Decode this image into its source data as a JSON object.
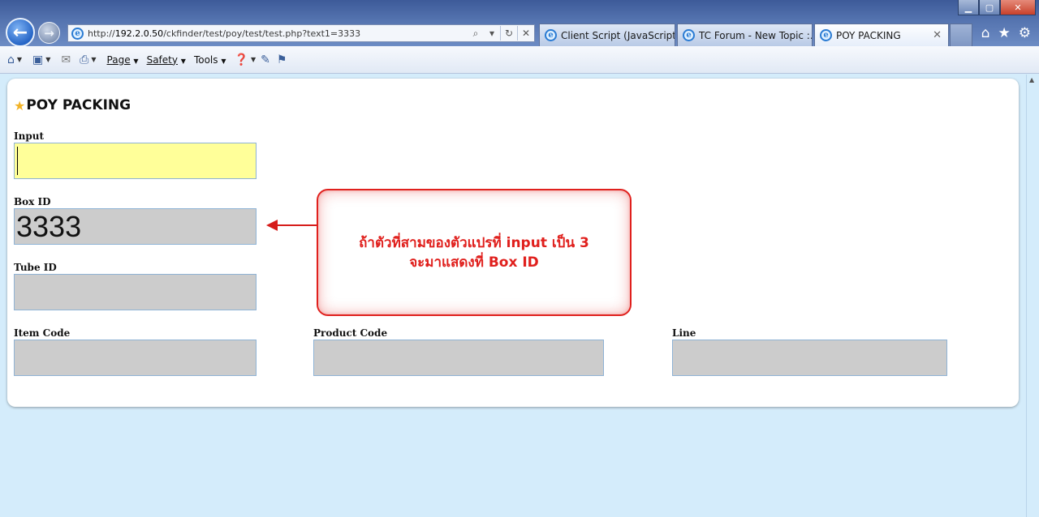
{
  "browser": {
    "url_prefix": "http://",
    "url_host": "192.2.0.50",
    "url_path": "/ckfinder/test/poy/test/test.php?text1=3333",
    "tabs": [
      {
        "label": "Client Script (JavaScript, ...",
        "active": false
      },
      {
        "label": "TC Forum - New Topic :...",
        "active": false
      },
      {
        "label": "POY PACKING",
        "active": true
      }
    ],
    "window_controls": {
      "minimize": "▁",
      "maximize": "▢",
      "close": "✕"
    },
    "right_icons": [
      "home-icon",
      "favorites-star-icon",
      "settings-gear-icon"
    ]
  },
  "command_bar": {
    "menus": [
      {
        "label": "Page"
      },
      {
        "label": "Safety"
      },
      {
        "label": "Tools"
      }
    ],
    "icons": [
      "home-icon",
      "feeds-icon",
      "mail-icon",
      "print-icon",
      "help-icon",
      "research-icon",
      "translate-icon"
    ]
  },
  "page": {
    "title": "POY PACKING",
    "title_icon": "star-icon",
    "fields": {
      "input": {
        "label": "Input",
        "value": "",
        "color": "#ffff99"
      },
      "box_id": {
        "label": "Box ID",
        "value": "3333",
        "color": "#cccccc"
      },
      "tube_id": {
        "label": "Tube ID",
        "value": "",
        "color": "#cccccc"
      },
      "item_code": {
        "label": "Item Code",
        "value": "",
        "color": "#cccccc"
      },
      "product_code": {
        "label": "Product Code",
        "value": "",
        "color": "#cccccc"
      },
      "line": {
        "label": "Line",
        "value": "",
        "color": "#cccccc"
      }
    }
  },
  "annotation": {
    "line1": "ถ้าตัวที่สามของตัวแปรที่ input เป็น 3",
    "line2": "จะมาแสดงที่ Box ID",
    "color": "#e0201d"
  }
}
